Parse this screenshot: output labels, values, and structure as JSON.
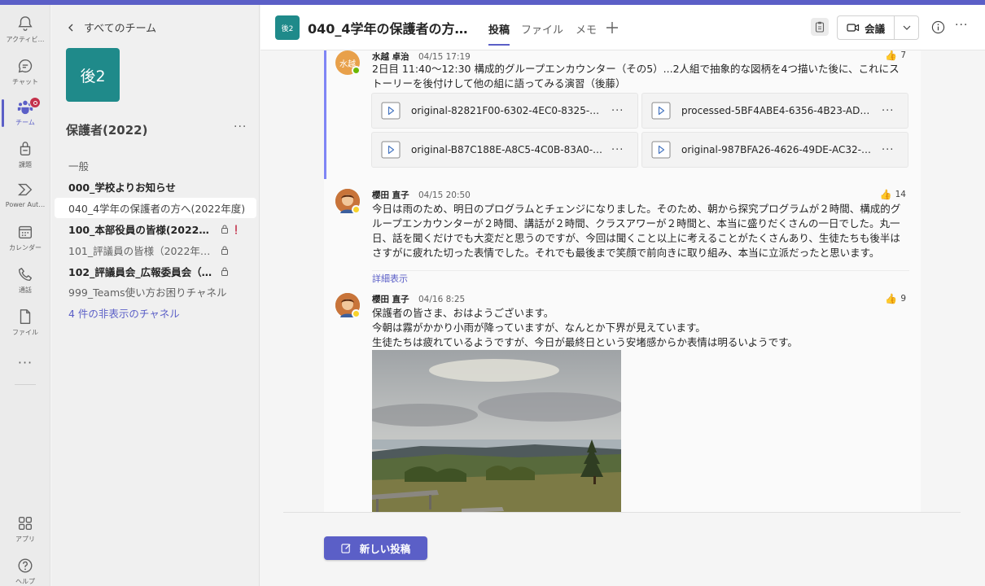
{
  "rail": {
    "items": [
      {
        "label": "アクティビ…",
        "icon": "bell-icon"
      },
      {
        "label": "チャット",
        "icon": "chat-icon"
      },
      {
        "label": "チーム",
        "icon": "teams-icon"
      },
      {
        "label": "課題",
        "icon": "assignments-icon"
      },
      {
        "label": "Power Aut…",
        "icon": "power-automate-icon"
      },
      {
        "label": "カレンダー",
        "icon": "calendar-icon"
      },
      {
        "label": "通話",
        "icon": "phone-icon"
      },
      {
        "label": "ファイル",
        "icon": "file-icon"
      },
      {
        "label": "アプリ",
        "icon": "apps-icon"
      },
      {
        "label": "ヘルプ",
        "icon": "help-icon"
      }
    ],
    "more": "···"
  },
  "pane": {
    "back_label": "すべてのチーム",
    "tile_text": "後2",
    "team_name": "保護者(2022)",
    "team_more": "···",
    "channels": [
      {
        "label": "一般"
      },
      {
        "label": "000_学校よりお知らせ"
      },
      {
        "label": "040_4学年の保護者の方へ(2022年度)"
      },
      {
        "label": "100_本部役員の皆様(2022年…"
      },
      {
        "label": "101_評議員の皆様（2022年度）"
      },
      {
        "label": "102_評議員会_広報委員会（202…"
      },
      {
        "label": "999_Teams使い方お困りチャネル"
      },
      {
        "label": "4 件の非表示のチャネル"
      }
    ]
  },
  "header": {
    "tile_text": "後2",
    "title": "040_4学年の保護者の方…",
    "tabs": [
      {
        "label": "投稿"
      },
      {
        "label": "ファイル"
      },
      {
        "label": "メモ"
      }
    ],
    "add_tab": "+",
    "meet_label": "会議",
    "more": "···"
  },
  "posts": [
    {
      "avatar_text": "水越",
      "avatar_color": "#e8a04a",
      "author": "水越 卓治",
      "time": "04/15 17:19",
      "likes": "7",
      "body": "2日目 11:40〜12:30 構成的グループエンカウンター（その5）...2人組で抽象的な図柄を4つ描いた後に、これにストーリーを後付けして他の組に語ってみる演習（後藤）",
      "files": [
        {
          "name": "original-82821F00-6302-4EC0-8325-06…",
          "more": "···"
        },
        {
          "name": "processed-5BF4ABE4-6356-4B23-AD5F…",
          "more": "···"
        },
        {
          "name": "original-B87C188E-A8C5-4C0B-83A0-5…",
          "more": "···"
        },
        {
          "name": "original-987BFA26-4626-49DE-AC32-12…",
          "more": "···"
        }
      ]
    },
    {
      "author": "櫻田 直子",
      "time": "04/15 20:50",
      "likes": "14",
      "body": "今日は雨のため、明日のプログラムとチェンジになりました。そのため、朝から探究プログラムが２時間、構成的グループエンカウンターが２時間、講話が２時間、クラスアワーが２時間と、本当に盛りだくさんの一日でした。丸一日、話を聞くだけでも大変だと思うのですが、今回は聞くこと以上に考えることがたくさんあり、生徒たちも後半はさすがに疲れた切った表情でした。それでも最後まで笑顔で前向きに取り組み、本当に立派だったと思います。",
      "see_more": "詳細表示"
    },
    {
      "author": "櫻田 直子",
      "time": "04/16 8:25",
      "likes": "9",
      "lines": [
        "保護者の皆さま、おはようございます。",
        "今朝は霧がかかり小雨が降っていますが、なんとか下界が見えています。",
        "生徒たちは疲れているようですが、今日が最終日という安堵感からか表情は明るいようです。"
      ]
    }
  ],
  "compose": {
    "new_post_label": "新しい投稿"
  },
  "colors": {
    "brand": "#5b5fc7",
    "team_tile": "#1f8a8a",
    "badge": "#c4314b",
    "like": "#e8a63c"
  }
}
